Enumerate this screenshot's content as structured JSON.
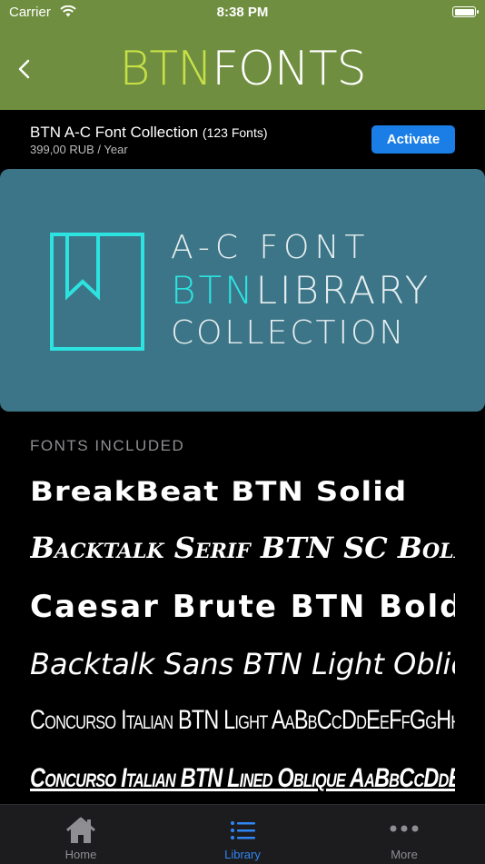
{
  "status": {
    "carrier": "Carrier",
    "time": "8:38 PM"
  },
  "nav": {
    "logo_part1": "BTN",
    "logo_part2": "FONTS"
  },
  "product": {
    "title": "BTN A-C Font Collection",
    "count": "(123 Fonts)",
    "price": "399,00 RUB / Year",
    "activate_label": "Activate"
  },
  "banner": {
    "line1": "A-C FONT",
    "line2_accent": "BTN",
    "line2_rest": "LIBRARY",
    "line3": "COLLECTION"
  },
  "fonts": {
    "section_label": "FONTS INCLUDED",
    "items": [
      "BreakBeat BTN Solid",
      "Backtalk Serif BTN SC Bold",
      "Caesar Brute BTN Bold",
      "Backtalk Sans BTN Light Oblique",
      "Concurso Italian BTN Light AaBbCcDdEeFfGgHhIiJj",
      "Concurso Italian BTN Lined Oblique AaBbCcDdEeFf"
    ]
  },
  "tabs": [
    {
      "label": "Home",
      "icon": "house-icon"
    },
    {
      "label": "Library",
      "icon": "list-icon"
    },
    {
      "label": "More",
      "icon": "ellipsis-icon"
    }
  ],
  "colors": {
    "nav_green": "#6f8e3f",
    "logo_accent": "#c7e048",
    "banner_bg": "#3c7587",
    "banner_accent": "#2de3e0",
    "activate_blue": "#1a7ee6",
    "tab_active": "#2f86f6"
  }
}
